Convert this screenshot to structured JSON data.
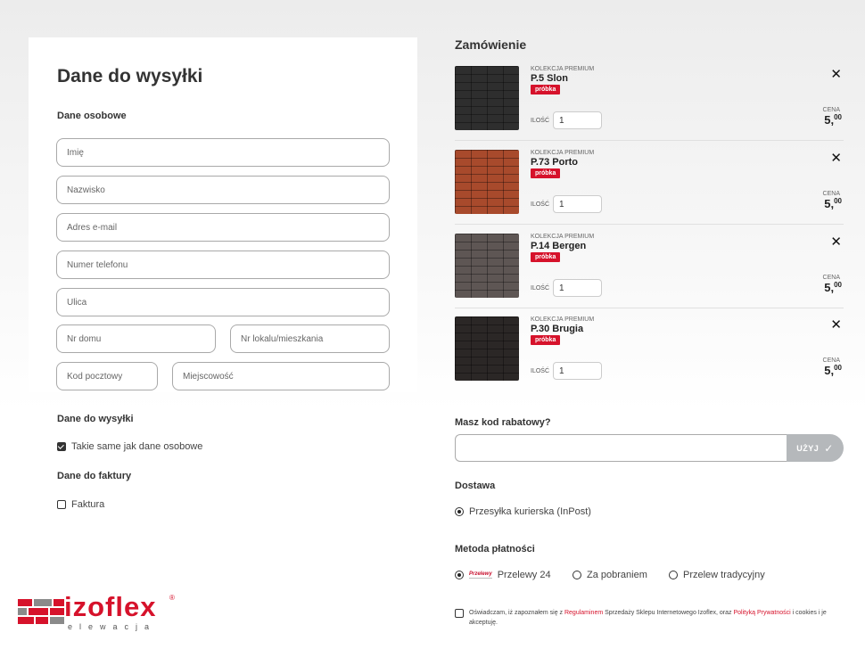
{
  "shipping_form": {
    "title": "Dane do wysyłki",
    "personal_section": "Dane osobowe",
    "fields": {
      "first_name": "Imię",
      "last_name": "Nazwisko",
      "email": "Adres e-mail",
      "phone": "Numer telefonu",
      "street": "Ulica",
      "house_no": "Nr domu",
      "apartment_no": "Nr lokalu/mieszkania",
      "postal_code": "Kod pocztowy",
      "city": "Miejscowość"
    },
    "shipping_section": "Dane do wysyłki",
    "same_as_personal": {
      "label": "Takie same jak dane osobowe",
      "checked": true
    },
    "invoice_section": "Dane do faktury",
    "invoice": {
      "label": "Faktura",
      "checked": false
    }
  },
  "order": {
    "title": "Zamówienie",
    "qty_label": "ILOŚĆ",
    "price_label": "CENA",
    "items": [
      {
        "collection": "KOLEKCJA PREMIUM",
        "name": "P.5 Slon",
        "badge": "próbka",
        "qty": "1",
        "price_int": "5,",
        "price_dec": "00",
        "swatch": "#2e2e2e"
      },
      {
        "collection": "KOLEKCJA PREMIUM",
        "name": "P.73 Porto",
        "badge": "próbka",
        "qty": "1",
        "price_int": "5,",
        "price_dec": "00",
        "swatch": "#a84a2c"
      },
      {
        "collection": "KOLEKCJA PREMIUM",
        "name": "P.14 Bergen",
        "badge": "próbka",
        "qty": "1",
        "price_int": "5,",
        "price_dec": "00",
        "swatch": "#5e5654"
      },
      {
        "collection": "KOLEKCJA PREMIUM",
        "name": "P.30 Brugia",
        "badge": "próbka",
        "qty": "1",
        "price_int": "5,",
        "price_dec": "00",
        "swatch": "#2b2726"
      }
    ]
  },
  "coupon": {
    "question": "Masz kod rabatowy?",
    "value": "",
    "button": "UŻYJ"
  },
  "delivery": {
    "title": "Dostawa",
    "option": "Przesyłka kurierska (InPost)"
  },
  "payment": {
    "title": "Metoda płatności",
    "p24_logo": "Przelewy",
    "options": [
      "Przelewy 24",
      "Za pobraniem",
      "Przelew tradycyjny"
    ],
    "selected": 0
  },
  "consent": {
    "text_1": "Oświadczam, iż zapoznałem się z ",
    "link_1": "Regulaminem",
    "text_2": " Sprzedaży Sklepu Internetowego Izoflex, oraz ",
    "link_2": "Polityką Prywatności",
    "text_3": " i cookies i je akceptuję."
  },
  "brand": {
    "logo_main": "izoflex",
    "logo_sub": "elewacja",
    "trademark": "®"
  },
  "colors": {
    "accent": "#d6122b",
    "button_gray": "#b5b8bb"
  }
}
